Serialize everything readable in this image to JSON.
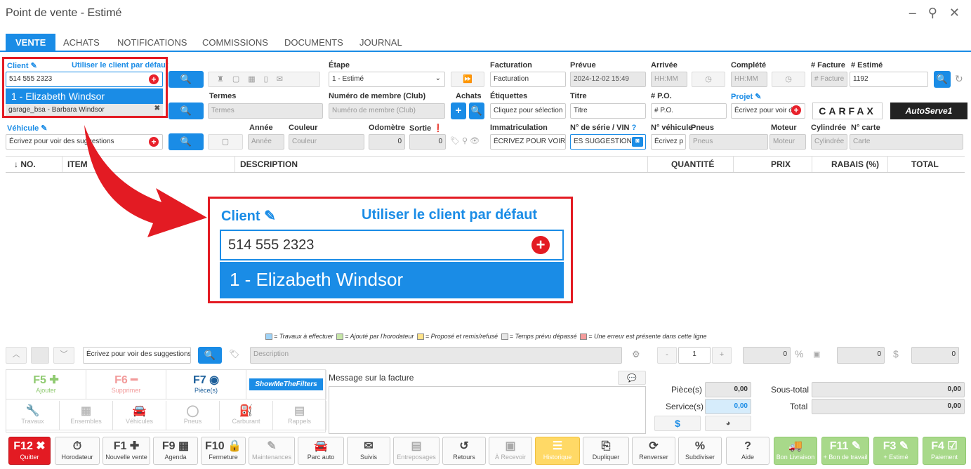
{
  "window": {
    "title": "Point de vente - Estimé",
    "controls": "– ⚲ ✕"
  },
  "tabs": [
    "VENTE",
    "ACHATS",
    "NOTIFICATIONS",
    "COMMISSIONS",
    "DOCUMENTS",
    "JOURNAL"
  ],
  "client": {
    "label": "Client",
    "default_link": "Utiliser le client par défaut",
    "value": "514 555 2323",
    "suggestion": "1 - Elizabeth Windsor",
    "vehicle_owner": "garage_bsa - Barbara Windsor"
  },
  "etape": {
    "label": "Étape",
    "value": "1 - Estimé"
  },
  "facturation": {
    "label": "Facturation",
    "placeholder": "Facturation"
  },
  "prevue": {
    "label": "Prévue",
    "value": "2024-12-02 15:49"
  },
  "arrivee": {
    "label": "Arrivée",
    "placeholder": "HH:MM"
  },
  "complete": {
    "label": "Complété",
    "placeholder": "HH:MM"
  },
  "num_facture": {
    "label": "# Facture",
    "placeholder": "# Facture"
  },
  "num_estime": {
    "label": "# Estimé",
    "value": "1192"
  },
  "termes": {
    "label": "Termes",
    "placeholder": "Termes"
  },
  "membre": {
    "label": "Numéro de membre (Club)",
    "placeholder": "Numéro de membre (Club)"
  },
  "achats_label": "Achats",
  "etiquettes": {
    "label": "Étiquettes",
    "placeholder": "Cliquez pour sélection"
  },
  "titre": {
    "label": "Titre",
    "placeholder": "Titre"
  },
  "po": {
    "label": "# P.O.",
    "placeholder": "# P.O."
  },
  "projet": {
    "label": "Projet",
    "placeholder": "Écrivez pour voir d"
  },
  "carfax": "CARFAX",
  "autoserve": "AutoServe1",
  "vehicule": {
    "label": "Véhicule",
    "placeholder": "Écrivez pour voir des suggestions"
  },
  "annee": {
    "label": "Année",
    "placeholder": "Année"
  },
  "couleur": {
    "label": "Couleur",
    "placeholder": "Couleur"
  },
  "odometre": {
    "label": "Odomètre",
    "value": "0"
  },
  "sortie": {
    "label": "Sortie",
    "value": "0"
  },
  "immatriculation": {
    "label": "Immatriculation",
    "placeholder": "ÉCRIVEZ POUR VOIR D"
  },
  "vin": {
    "label": "N° de série / VIN",
    "placeholder": "ES SUGGESTIONS"
  },
  "nvehicule": {
    "label": "N° véhicule",
    "placeholder": "Écrivez p"
  },
  "pneus": {
    "label": "Pneus",
    "placeholder": "Pneus"
  },
  "moteur": {
    "label": "Moteur",
    "placeholder": "Moteur"
  },
  "cylindree": {
    "label": "Cylindrée",
    "placeholder": "Cylindrée"
  },
  "ncarte": {
    "label": "N° carte",
    "placeholder": "Carte"
  },
  "table_headers": [
    "↓ NO.",
    "ITEM",
    "DESCRIPTION",
    "QUANTITÉ",
    "PRIX",
    "RABAIS (%)",
    "TOTAL"
  ],
  "zoom": {
    "client_label": "Client",
    "default_link": "Utiliser le client par défaut",
    "value": "514 555 2323",
    "suggestion": "1 - Elizabeth Windsor"
  },
  "legend": [
    {
      "color": "#9fd3f7",
      "text": "= Travaux à effectuer"
    },
    {
      "color": "#c6e6a8",
      "text": "= Ajouté par l'horodateur"
    },
    {
      "color": "#ffe38a",
      "text": "= Proposé et remis/refusé"
    },
    {
      "color": "#e6e6e6",
      "text": "= Temps prévu dépassé"
    },
    {
      "color": "#f59c9c",
      "text": "= Une erreur est présente dans cette ligne"
    }
  ],
  "item_entry": {
    "search_placeholder": "Écrivez pour voir des suggestions",
    "desc_placeholder": "Description",
    "minus": "-",
    "qty": "1",
    "plus": "+",
    "pct": "0",
    "pct_sign": "%",
    "amount": "0",
    "dollar": "$",
    "total": "0"
  },
  "tiles": [
    {
      "key": "F5",
      "label": "Ajouter"
    },
    {
      "key": "F6",
      "label": "Supprimer"
    },
    {
      "key": "F7",
      "label": "Pièce(s)"
    },
    {
      "key": "ShowMeTheFilters",
      "label": ""
    },
    {
      "key": "",
      "label": "Travaux"
    },
    {
      "key": "",
      "label": "Ensembles"
    },
    {
      "key": "",
      "label": "Véhicules"
    },
    {
      "key": "",
      "label": "Pneus"
    },
    {
      "key": "",
      "label": "Carburant"
    },
    {
      "key": "",
      "label": "Rappels"
    }
  ],
  "message_label": "Message sur la facture",
  "totals": {
    "pieces_label": "Pièce(s)",
    "pieces": "0,00",
    "service_label": "Service(s)",
    "service": "0,00",
    "soustotal_label": "Sous-total",
    "soustotal": "0,00",
    "total_label": "Total",
    "total": "0,00"
  },
  "fkeys": [
    {
      "key": "F12 ✖",
      "label": "Quitter"
    },
    {
      "key": "⏱",
      "label": "Horodateur"
    },
    {
      "key": "F1 ✚",
      "label": "Nouvelle vente"
    },
    {
      "key": "F9 ▦",
      "label": "Agenda"
    },
    {
      "key": "F10 🔒",
      "label": "Fermeture"
    },
    {
      "key": "✎",
      "label": "Maintenances"
    },
    {
      "key": "🚘",
      "label": "Parc auto"
    },
    {
      "key": "✉",
      "label": "Suivis"
    },
    {
      "key": "▤",
      "label": "Entreposages"
    },
    {
      "key": "↺",
      "label": "Retours"
    },
    {
      "key": "▣",
      "label": "À Recevoir"
    },
    {
      "key": "☰",
      "label": "Historique"
    },
    {
      "key": "⎘",
      "label": "Dupliquer"
    },
    {
      "key": "⟳",
      "label": "Renverser"
    },
    {
      "key": "%",
      "label": "Subdiviser"
    },
    {
      "key": "?",
      "label": "Aide"
    },
    {
      "key": "🚚",
      "label": "Bon Livraison"
    },
    {
      "key": "F11 ✎",
      "label": "+ Bon de travail"
    },
    {
      "key": "F3 ✎",
      "label": "+ Estimé"
    },
    {
      "key": "F4 ☑",
      "label": "Paiement"
    }
  ]
}
